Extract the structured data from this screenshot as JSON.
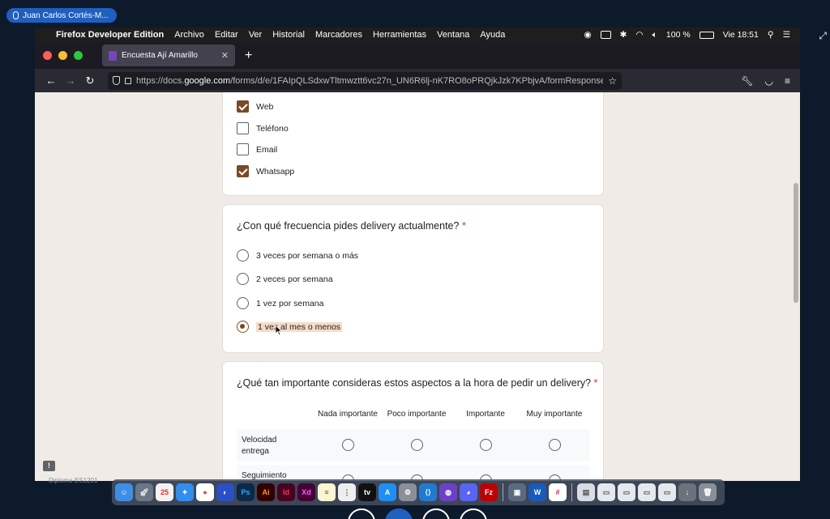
{
  "zoom": {
    "speaker": "Juan Carlos Cortés-M..."
  },
  "menubar": {
    "items": [
      "Firefox Developer Edition",
      "Archivo",
      "Editar",
      "Ver",
      "Historial",
      "Marcadores",
      "Herramientas",
      "Ventana",
      "Ayuda"
    ],
    "battery": "100 %",
    "clock": "Vie 18:51"
  },
  "browser": {
    "tab_title": "Encuesta Ají Amarillo",
    "url_prefix": "https://docs.",
    "url_domain": "google.com",
    "url_rest": "/forms/d/e/1FAIpQLSdxwTltmwztt6vc27n_UN6R6lj-nK7RO8oPRQjkJzk7KPbjvA/formResponse"
  },
  "form": {
    "channels": [
      {
        "label": "Web",
        "checked": true
      },
      {
        "label": "Teléfono",
        "checked": false
      },
      {
        "label": "Email",
        "checked": false
      },
      {
        "label": "Whatsapp",
        "checked": true
      }
    ],
    "q_frequency": {
      "title": "¿Con qué frecuencia pides delivery actualmente?",
      "required_mark": "*",
      "options": [
        "3 veces por semana o más",
        "2 veces por semana",
        "1 vez por semana",
        "1 vez al mes o menos"
      ],
      "selected_index": 3
    },
    "q_importance": {
      "title": "¿Qué tan importante consideras estos aspectos a la hora de pedir un delivery?",
      "required_mark": "*",
      "columns": [
        "Nada importante",
        "Poco importante",
        "Importante",
        "Muy importante"
      ],
      "rows": [
        "Velocidad entrega",
        "Seguimiento del"
      ]
    }
  },
  "dock": {
    "behind_text": "Diploma-ES1201"
  },
  "colors": {
    "accent": "#7a4a23",
    "required": "#d93025",
    "zoom_blue": "#1f5fbf"
  }
}
